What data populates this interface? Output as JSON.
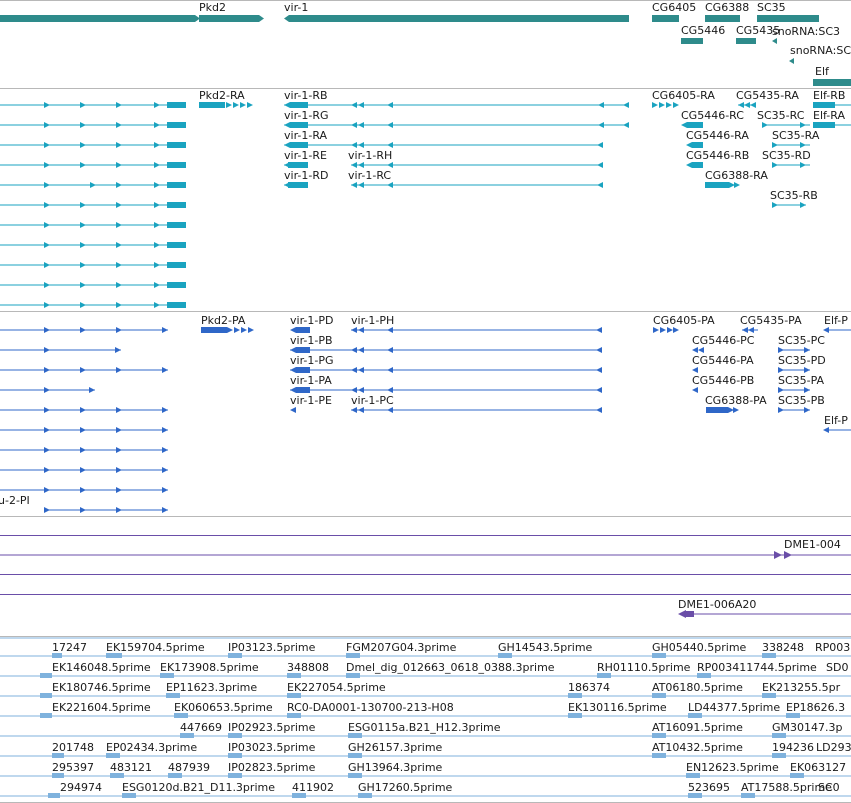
{
  "colors": {
    "genes": "#2e8b8b",
    "rna": "#1aa3c0",
    "protein": "#2f67c8",
    "pcr": "#6a4ea8",
    "est": "#7fb2dd",
    "divider": "#b8b8b8"
  },
  "tracks": [
    {
      "name": "genes",
      "color": "#2e8b8b",
      "features": [
        {
          "label": "Pkd2",
          "start": 0,
          "end": 0
        },
        {
          "label": "vir-1",
          "start": 0,
          "end": 0
        },
        {
          "label": "CG6405"
        },
        {
          "label": "CG6388"
        },
        {
          "label": "SC35"
        },
        {
          "label": "CG5446"
        },
        {
          "label": "CG5435"
        },
        {
          "label": "snoRNA:SC3"
        },
        {
          "label": "snoRNA:SC"
        },
        {
          "label": "Elf"
        }
      ]
    },
    {
      "name": "rna",
      "color": "#1aa3c0",
      "labels": [
        "Pkd2-RA",
        "vir-1-RB",
        "vir-1-RG",
        "vir-1-RA",
        "vir-1-RE",
        "vir-1-RH",
        "vir-1-RD",
        "vir-1-RC",
        "CG6405-RA",
        "CG5435-RA",
        "Elf-RB",
        "CG5446-RC",
        "SC35-RC",
        "Elf-RA",
        "CG5446-RA",
        "SC35-RA",
        "CG5446-RB",
        "SC35-RD",
        "CG6388-RA",
        "SC35-RB"
      ]
    },
    {
      "name": "protein",
      "color": "#2f67c8",
      "labels": [
        "Pkd2-PA",
        "vir-1-PD",
        "vir-1-PH",
        "vir-1-PB",
        "vir-1-PG",
        "vir-1-PA",
        "vir-1-PE",
        "vir-1-PC",
        "CG6405-PA",
        "CG5435-PA",
        "Elf-P",
        "CG5446-PC",
        "SC35-PC",
        "CG5446-PA",
        "SC35-PD",
        "CG5446-PB",
        "SC35-PA",
        "CG6388-PA",
        "SC35-PB",
        "Elf-P",
        "u-2-PI"
      ]
    },
    {
      "name": "pcr",
      "color": "#6a4ea8",
      "labels": [
        "DME1-004",
        "DME1-006A20"
      ]
    },
    {
      "name": "est",
      "color": "#7fb2dd",
      "labels": [
        "17247",
        "EK159704.5prime",
        "IP03123.5prime",
        "FGM207G04.3prime",
        "GH14543.5prime",
        "GH05440.5prime",
        "338248",
        "RP003",
        "EK146048.5prime",
        "EK173908.5prime",
        "348808",
        "Dmel_dig_012663_0618_0388.3prime",
        "RH01110.5prime",
        "RP003411744.5prime",
        "SD0",
        "EK180746.5prime",
        "EP11623.3prime",
        "EK227054.5prime",
        "186374",
        "AT06180.5prime",
        "EK213255.5pr",
        "EK221604.5prime",
        "EK060653.5prime",
        "RC0-DA0001-130700-213-H08",
        "EK130116.5prime",
        "LD44377.5prime",
        "EP18626.3",
        "447669",
        "IP02923.5prime",
        "ESG0115a.B21_H12.3prime",
        "AT16091.5prime",
        "GM30147.3p",
        "201748",
        "EP02434.3prime",
        "IP03023.5prime",
        "GH26157.3prime",
        "AT10432.5prime",
        "194236",
        "LD293",
        "295397",
        "483121",
        "487939",
        "IP02823.5prime",
        "GH13964.3prime",
        "EN12623.5prime",
        "EK063127",
        "294974",
        "ESG0120d.B21_D11.3prime",
        "411902",
        "GH17260.5prime",
        "523695",
        "AT17588.5prime",
        "SC0"
      ]
    }
  ]
}
